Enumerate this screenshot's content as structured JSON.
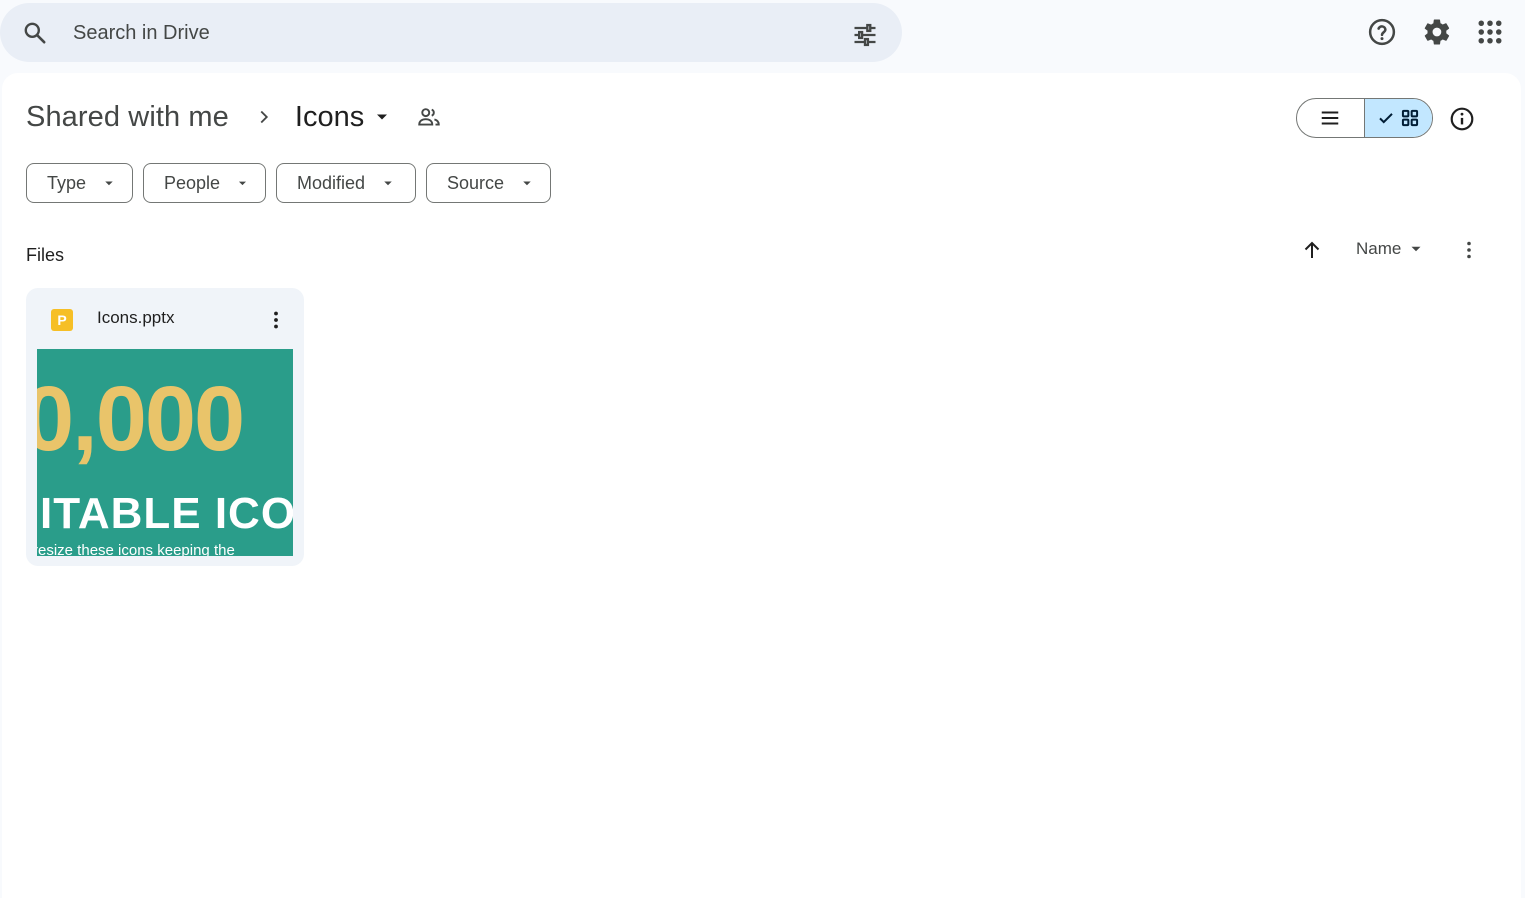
{
  "search": {
    "placeholder": "Search in Drive",
    "icon": "search-icon",
    "options_icon": "tune-icon"
  },
  "top_actions": {
    "icons": [
      "help-icon",
      "settings-icon",
      "apps-grid-icon"
    ]
  },
  "breadcrumb": {
    "root": "Shared with me",
    "current": "Icons",
    "current_shared_icon": "shared-folder-people-icon"
  },
  "view_toggle": {
    "options": [
      "list",
      "grid"
    ],
    "selected": "grid"
  },
  "filters": {
    "type": "Type",
    "people": "People",
    "modified": "Modified",
    "source": "Source"
  },
  "files_section": {
    "title": "Files",
    "sort_by": "Name",
    "sort_direction": "ascending"
  },
  "files": [
    {
      "name": "Icons.pptx",
      "type_icon_letter": "P",
      "type_color": "#f6bf26",
      "thumbnail": {
        "line1": "0,000",
        "line2": "ITABLE ICO",
        "line3": "resize these icons keeping the"
      }
    }
  ],
  "colors": {
    "background": "#f8fafd",
    "search_bg": "#e9eef6",
    "card_bg": "#f0f4f9",
    "toggle_selected": "#c2e7ff",
    "thumb_bg": "#2a9d8a",
    "thumb_accent": "#e9c46a"
  }
}
